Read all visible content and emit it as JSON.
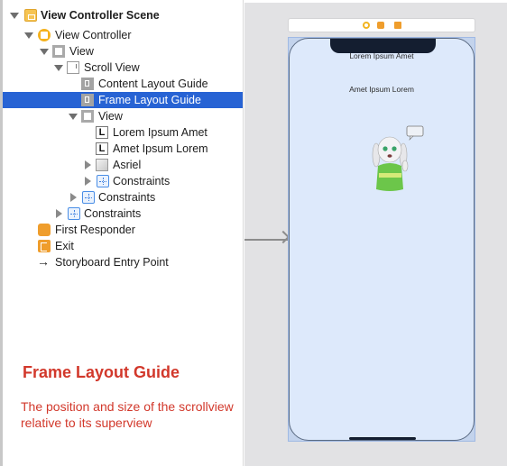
{
  "outline": {
    "items": [
      {
        "label": "View Controller Scene",
        "icon": "storyboard-scene-icon",
        "disclosure": "expanded",
        "bold": true,
        "selected": false
      },
      {
        "label": "View Controller",
        "icon": "view-controller-icon",
        "disclosure": "expanded",
        "selected": false
      },
      {
        "label": "View",
        "icon": "view-icon",
        "disclosure": "expanded",
        "selected": false
      },
      {
        "label": "Scroll View",
        "icon": "scroll-view-icon",
        "disclosure": "expanded",
        "selected": false
      },
      {
        "label": "Content Layout Guide",
        "icon": "layout-guide-icon",
        "disclosure": "none",
        "selected": false
      },
      {
        "label": "Frame Layout Guide",
        "icon": "layout-guide-icon",
        "disclosure": "none",
        "selected": true
      },
      {
        "label": "View",
        "icon": "view-icon",
        "disclosure": "expanded",
        "selected": false
      },
      {
        "label": "Lorem Ipsum Amet",
        "icon": "label-icon",
        "disclosure": "none",
        "selected": false
      },
      {
        "label": "Amet Ipsum Lorem",
        "icon": "label-icon",
        "disclosure": "none",
        "selected": false
      },
      {
        "label": "Asriel",
        "icon": "image-view-icon",
        "disclosure": "collapsed",
        "selected": false
      },
      {
        "label": "Constraints",
        "icon": "constraints-icon",
        "disclosure": "collapsed",
        "selected": false
      },
      {
        "label": "Constraints",
        "icon": "constraints-icon",
        "disclosure": "collapsed",
        "selected": false
      },
      {
        "label": "Constraints",
        "icon": "constraints-icon",
        "disclosure": "collapsed",
        "selected": false
      },
      {
        "label": "First Responder",
        "icon": "first-responder-icon",
        "disclosure": "none",
        "selected": false
      },
      {
        "label": "Exit",
        "icon": "exit-icon",
        "disclosure": "none",
        "selected": false
      },
      {
        "label": "Storyboard Entry Point",
        "icon": "entry-arrow-icon",
        "disclosure": "none",
        "selected": false
      }
    ],
    "label_icon_glyph": "L"
  },
  "caption": {
    "title": "Frame Layout Guide",
    "body": "The position and size of the scrollview relative to its superview"
  },
  "canvas": {
    "scene_bar_icons": [
      "view-controller-icon",
      "first-responder-icon",
      "exit-icon"
    ],
    "phone": {
      "label1": "Lorem Ipsum Amet",
      "label2": "Amet Ipsum Lorem",
      "image_name": "Asriel"
    }
  },
  "colors": {
    "selection": "#2763d4",
    "caption": "#d2382b",
    "phone_background": "#dde9fb",
    "canvas_background": "#e2e2e4"
  }
}
